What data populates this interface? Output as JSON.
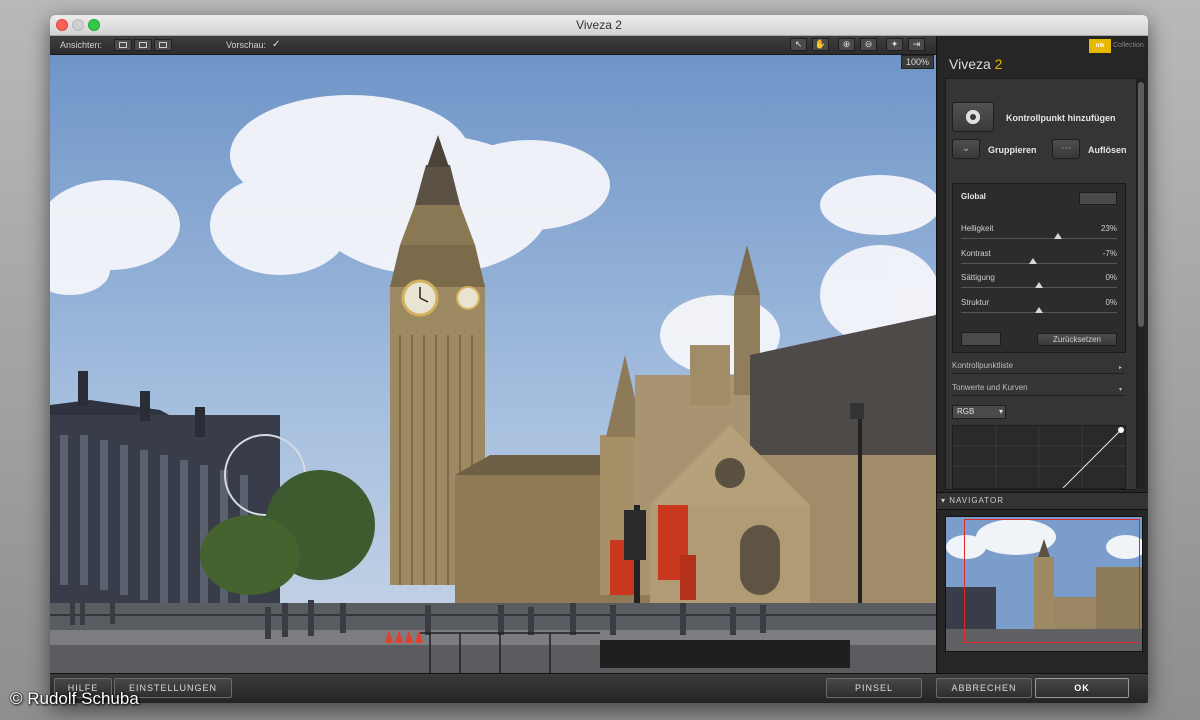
{
  "window": {
    "title": "Viveza 2"
  },
  "toolbar": {
    "views_label": "Ansichten:",
    "preview_label": "Vorschau:",
    "preview_checked_glyph": "✓",
    "tools": [
      "move-icon",
      "hand-icon",
      "zoom-in-icon",
      "zoom-out-icon",
      "bulb-icon",
      "export-icon"
    ]
  },
  "preview": {
    "zoom": "100%"
  },
  "sidebar": {
    "brand": "nik",
    "brand_sub": "Collection",
    "title_name": "Viveza",
    "title_num": "2",
    "add_point": "Kontrollpunkt hinzufügen",
    "group": "Gruppieren",
    "ungroup": "Auflösen",
    "global": {
      "title": "Global",
      "sliders": [
        {
          "label": "Helligkeit",
          "value": "23%",
          "pos": 0.62
        },
        {
          "label": "Kontrast",
          "value": "-7%",
          "pos": 0.46
        },
        {
          "label": "Sättigung",
          "value": "0%",
          "pos": 0.5
        },
        {
          "label": "Struktur",
          "value": "0%",
          "pos": 0.5
        }
      ],
      "reset": "Zurücksetzen"
    },
    "control_point_list": "Kontrollpunktliste",
    "tones_curves": "Tonwerte und Kurven",
    "rgb": "RGB",
    "navigator": "NAVIGATOR"
  },
  "footer": {
    "help": "HILFE",
    "settings": "EINSTELLUNGEN",
    "brush": "PINSEL",
    "cancel": "ABBRECHEN",
    "ok": "OK"
  },
  "copyright": "© Rudolf Schuba"
}
